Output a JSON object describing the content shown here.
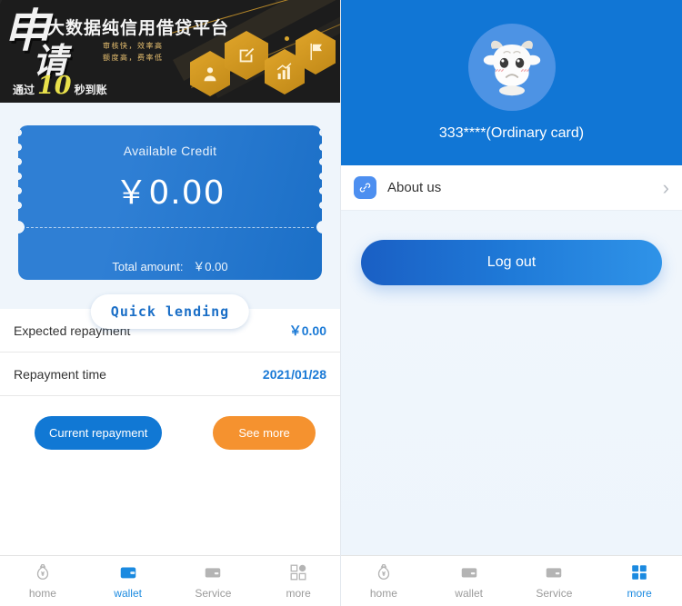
{
  "left_panel": {
    "banner": {
      "brush_char": "申",
      "brush_char2": "请",
      "title": "大数据纯信用借贷平台",
      "subtitle_1": "审核快，效率高",
      "subtitle_2": "额度高，费率低",
      "bottom_prefix": "通过",
      "bottom_number": "10",
      "bottom_suffix": "秒到账",
      "hex_icons": [
        "person-icon",
        "edit-icon",
        "chart-icon",
        "flag-icon"
      ]
    },
    "credit_card": {
      "available_label": "Available Credit",
      "available_amount": "￥0.00",
      "total_label": "Total amount:",
      "total_amount": "￥0.00",
      "quick_lending_label": "Quick lending",
      "accent": "#1b6fc7"
    },
    "repayment_rows": [
      {
        "label": "Expected repayment",
        "value": "￥0.00"
      },
      {
        "label": "Repayment time",
        "value": "2021/01/28"
      }
    ],
    "actions": {
      "current_repayment_label": "Current repayment",
      "current_repayment_color": "#1178d4",
      "see_more_label": "See more",
      "see_more_color": "#f5922f"
    },
    "tabbar": {
      "items": [
        {
          "label": "home",
          "icon": "money-bag-icon",
          "active": false
        },
        {
          "label": "wallet",
          "icon": "wallet-icon",
          "active": true
        },
        {
          "label": "Service",
          "icon": "service-icon",
          "active": false
        },
        {
          "label": "more",
          "icon": "grid-more-icon",
          "active": false
        }
      ]
    }
  },
  "right_panel": {
    "profile": {
      "avatar_icon": "cow-avatar-icon",
      "name": "333****(Ordinary card)",
      "header_color": "#1176d5"
    },
    "menu": [
      {
        "label": "About us",
        "icon": "link-icon",
        "chevron": "›"
      }
    ],
    "logout_label": "Log out",
    "tabbar": {
      "items": [
        {
          "label": "home",
          "icon": "money-bag-icon",
          "active": false
        },
        {
          "label": "wallet",
          "icon": "wallet-icon",
          "active": false
        },
        {
          "label": "Service",
          "icon": "service-icon",
          "active": false
        },
        {
          "label": "more",
          "icon": "grid-more-icon",
          "active": true
        }
      ]
    }
  }
}
